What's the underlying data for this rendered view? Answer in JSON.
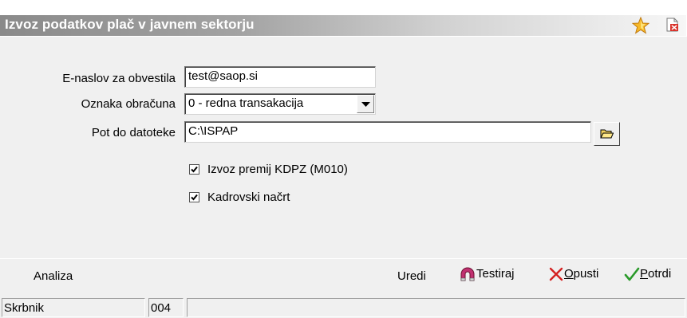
{
  "window": {
    "title": "Izvoz podatkov plač v javnem sektorju",
    "favorite_icon": "star-icon",
    "close_icon": "close-document-icon"
  },
  "form": {
    "email_label": "E-naslov za obvestila",
    "email_value": "test@saop.si",
    "calc_label": "Oznaka obračuna",
    "calc_value": "0 - redna transakacija",
    "path_label": "Pot do datoteke",
    "path_value": "C:\\ISPAP",
    "browse_icon": "folder-open-icon",
    "check_kdpz_label": "Izvoz premij KDPZ (M010)",
    "check_kdpz_checked": true,
    "check_kadrovski_label": "Kadrovski načrt",
    "check_kadrovski_checked": true
  },
  "actions": {
    "analiza": "Analiza",
    "uredi": "Uredi",
    "testiraj": "Testiraj",
    "opusti_u": "O",
    "opusti_rest": "pusti",
    "potrdi_u": "P",
    "potrdi_rest": "otrdi",
    "colors": {
      "opusti": "#d42020",
      "potrdi": "#2a9a2a",
      "testiraj": "#c03070"
    }
  },
  "status": {
    "user": "Skrbnik",
    "code": "004",
    "message": ""
  }
}
